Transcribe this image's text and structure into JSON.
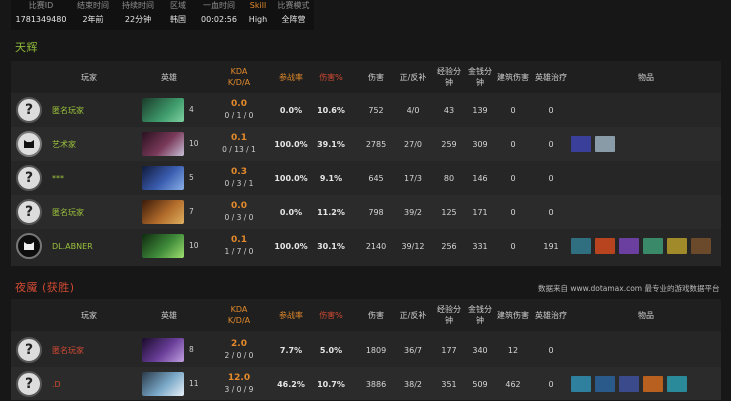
{
  "info": {
    "headers": [
      "比赛ID",
      "结束时间",
      "持续时间",
      "区域",
      "一血时间",
      "Skill",
      "比赛模式"
    ],
    "values": [
      "1781349480",
      "2年前",
      "22分钟",
      "韩国",
      "00:02:56",
      "High",
      "全阵营"
    ]
  },
  "radiant_title": "天辉",
  "dire_title": "夜魇 (获胜)",
  "source_note": "数据来自 www.dotamax.com 最专业的游戏数据平台",
  "columns": {
    "player": "玩家",
    "hero": "英雄",
    "kda1": "KDA",
    "kda2": "K/D/A",
    "participation": "参战率",
    "dmg_pct": "伤害%",
    "damage": "伤害",
    "lh_dn": "正/反补",
    "xpm1": "经验分",
    "xpm2": "钟",
    "gpm1": "金钱分",
    "gpm2": "钟",
    "tower_dmg": "建筑伤害",
    "healing": "英雄治疗",
    "items": "物品"
  },
  "radiant": [
    {
      "avatar": "?",
      "name": "匿名玩家",
      "level": "4",
      "kda": "0.0",
      "kda_detail": "0 / 1 / 0",
      "part": "0.0%",
      "dmgpct": "10.6%",
      "damage": "752",
      "lhdn": "4/0",
      "xpm": "43",
      "gpm": "139",
      "tower": "0",
      "heal": "0",
      "hero_color": "#3f9b6c",
      "items": []
    },
    {
      "avatar": "cat",
      "name": "艺术家",
      "level": "10",
      "kda": "0.1",
      "kda_detail": "0 / 13 / 1",
      "part": "100.0%",
      "dmgpct": "39.1%",
      "damage": "2785",
      "lhdn": "27/0",
      "xpm": "259",
      "gpm": "309",
      "tower": "0",
      "heal": "0",
      "hero_color": "#7a3a5a",
      "items": [
        "#3a3f9a",
        "#8a9ba8"
      ]
    },
    {
      "avatar": "?",
      "name": "***",
      "level": "5",
      "kda": "0.3",
      "kda_detail": "0 / 3 / 1",
      "part": "100.0%",
      "dmgpct": "9.1%",
      "damage": "645",
      "lhdn": "17/3",
      "xpm": "80",
      "gpm": "146",
      "tower": "0",
      "heal": "0",
      "hero_color": "#3b5db0",
      "items": []
    },
    {
      "avatar": "?",
      "name": "匿名玩家",
      "level": "7",
      "kda": "0.0",
      "kda_detail": "0 / 3 / 0",
      "part": "0.0%",
      "dmgpct": "11.2%",
      "damage": "798",
      "lhdn": "39/2",
      "xpm": "125",
      "gpm": "171",
      "tower": "0",
      "heal": "0",
      "hero_color": "#b06a2a",
      "items": []
    },
    {
      "avatar": "cat",
      "name": "DL.ABNER",
      "level": "10",
      "kda": "0.1",
      "kda_detail": "1 / 7 / 0",
      "part": "100.0%",
      "dmgpct": "30.1%",
      "damage": "2140",
      "lhdn": "39/12",
      "xpm": "256",
      "gpm": "331",
      "tower": "0",
      "heal": "191",
      "hero_color": "#3f8a3a",
      "items": [
        "#2f6f7f",
        "#b8431f",
        "#6a3fa0",
        "#3a8a6a",
        "#a08a2a",
        "#6a4a2a"
      ]
    }
  ],
  "dire": [
    {
      "avatar": "?",
      "name": "匿名玩家",
      "level": "8",
      "kda": "2.0",
      "kda_detail": "2 / 0 / 0",
      "part": "7.7%",
      "dmgpct": "5.0%",
      "damage": "1809",
      "lhdn": "36/7",
      "xpm": "177",
      "gpm": "340",
      "tower": "12",
      "heal": "0",
      "hero_color": "#6a3f9a",
      "items": []
    },
    {
      "avatar": "?",
      "name": ".D",
      "level": "11",
      "kda": "12.0",
      "kda_detail": "3 / 0 / 9",
      "part": "46.2%",
      "dmgpct": "10.7%",
      "damage": "3886",
      "lhdn": "38/2",
      "xpm": "351",
      "gpm": "509",
      "tower": "462",
      "heal": "0",
      "hero_color": "#7aa8c8",
      "items": [
        "#2f7f9f",
        "#2a5a8a",
        "#3a4a8a",
        "#b8601f",
        "#2a8a9a"
      ]
    }
  ],
  "colors": {
    "radiant": "#8fb83a",
    "dire": "#d14a33",
    "accent": "#e38a2b"
  }
}
